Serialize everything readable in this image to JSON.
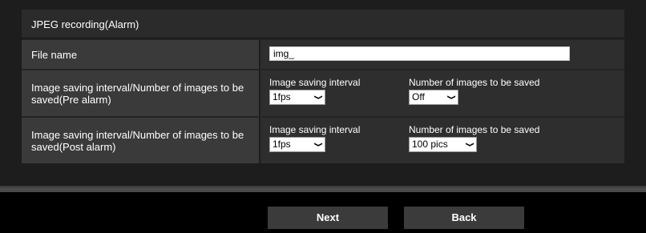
{
  "section": {
    "title": "JPEG recording(Alarm)"
  },
  "rows": {
    "file_name": {
      "label": "File name",
      "value": "img_"
    },
    "pre_alarm": {
      "label": "Image saving interval/Number of images to be saved(Pre alarm)",
      "interval_label": "Image saving interval",
      "interval_value": "1fps",
      "count_label": "Number of images to be saved",
      "count_value": "Off"
    },
    "post_alarm": {
      "label": "Image saving interval/Number of images to be saved(Post alarm)",
      "interval_label": "Image saving interval",
      "interval_value": "1fps",
      "count_label": "Number of images to be saved",
      "count_value": "100 pics"
    }
  },
  "buttons": {
    "next": "Next",
    "back": "Back"
  },
  "icons": {
    "select_arrow": "chevron-down-icon"
  },
  "colors": {
    "page_background": "#000000",
    "panel_background": "#1d1d1d",
    "label_cell": "#3a3a3a",
    "value_cell": "#2e2e2e",
    "button": "#3b3b3b"
  }
}
